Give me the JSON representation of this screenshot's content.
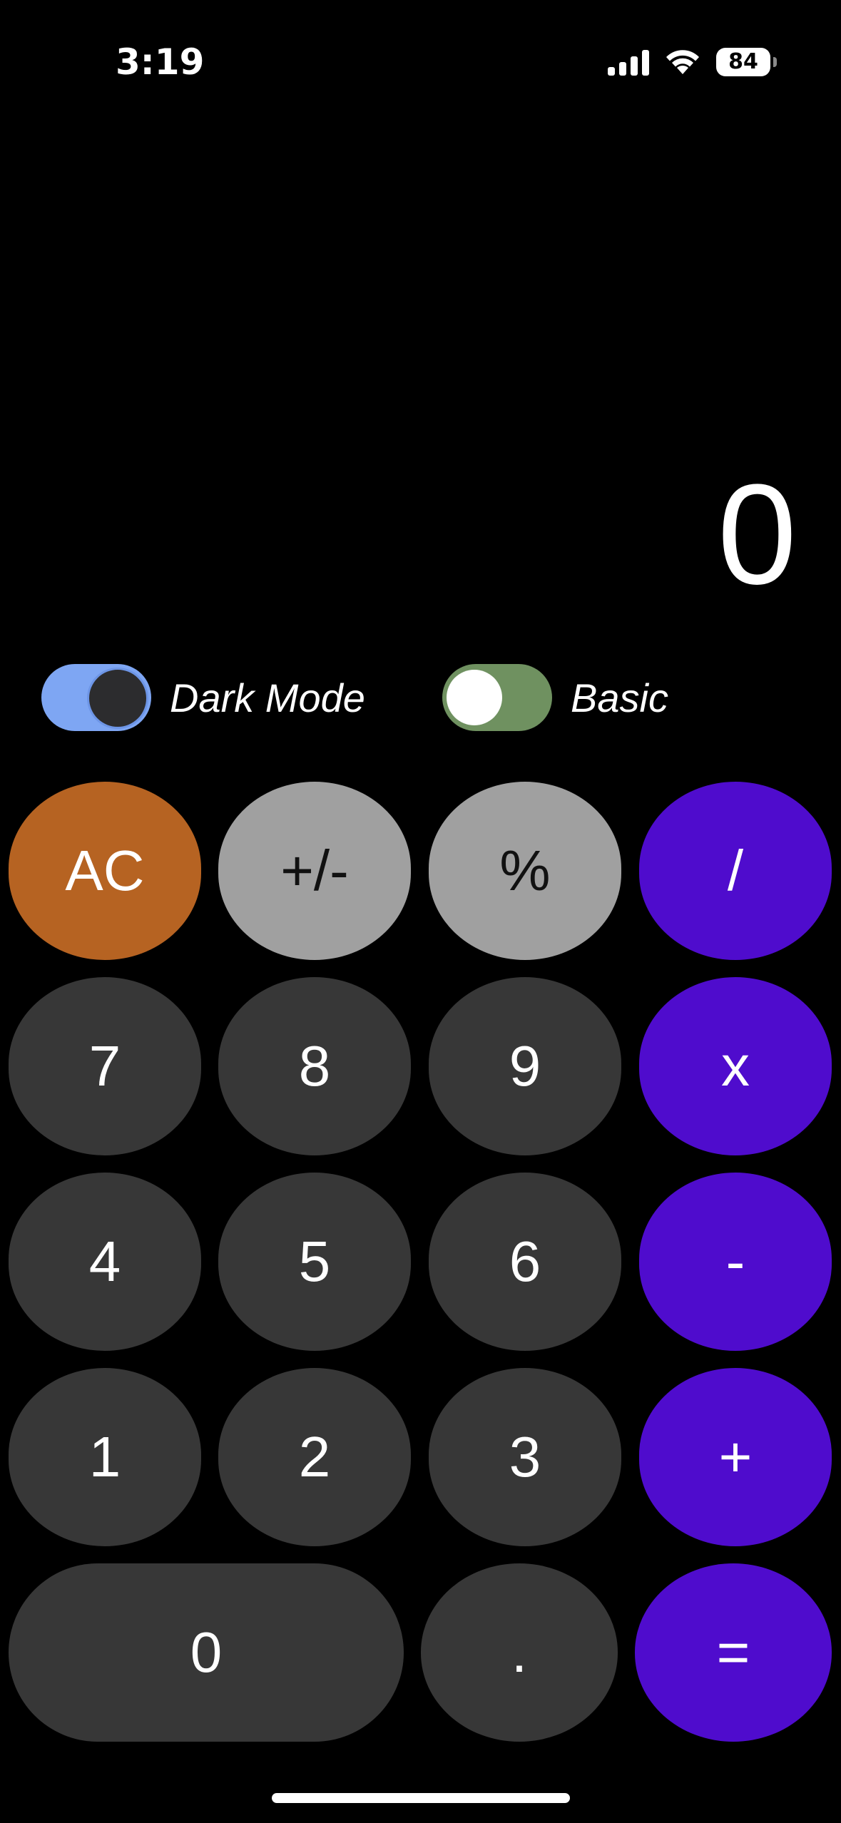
{
  "status_bar": {
    "time": "3:19",
    "battery": "84",
    "icons": [
      "cellular-signal-icon",
      "wifi-icon",
      "battery-icon"
    ]
  },
  "display": {
    "value": "0"
  },
  "toggles": {
    "dark_mode": {
      "label": "Dark Mode",
      "on": true
    },
    "basic": {
      "label": "Basic",
      "on": false
    }
  },
  "keypad": {
    "row1": [
      "AC",
      "+/-",
      "%",
      "/"
    ],
    "row2": [
      "7",
      "8",
      "9",
      "x"
    ],
    "row3": [
      "4",
      "5",
      "6",
      "-"
    ],
    "row4": [
      "1",
      "2",
      "3",
      "+"
    ],
    "row5": [
      "0",
      ".",
      "="
    ]
  },
  "colors": {
    "background": "#000000",
    "clear_key": "#b66322",
    "function_key": "#a0a0a0",
    "number_key": "#373737",
    "operator_key": "#4f0ccd",
    "dark_mode_toggle": "#7ea6f3",
    "basic_toggle": "#6f9160"
  }
}
